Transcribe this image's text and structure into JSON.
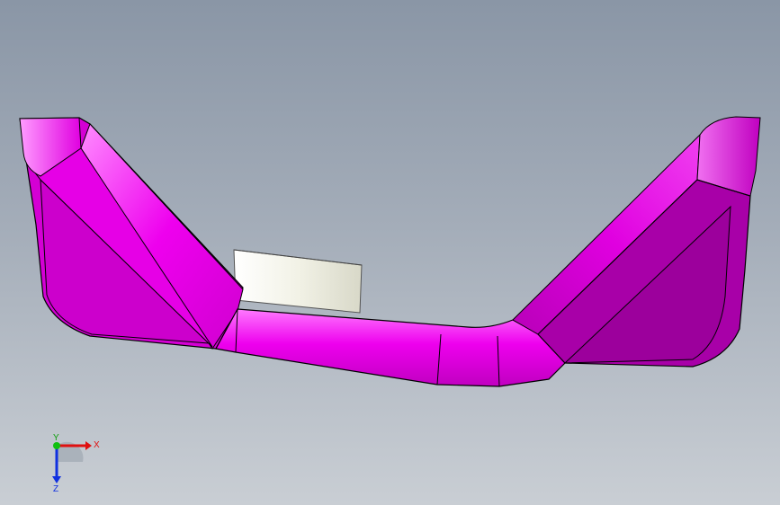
{
  "viewport": {
    "background_top": "#8a96a6",
    "background_bottom": "#c9ced4"
  },
  "model": {
    "part_color": "#ee00ee",
    "part_shadow_color": "#b000b0",
    "edge_color": "#000000",
    "insert_color": "#f2f2e6"
  },
  "triad": {
    "x_label": "X",
    "y_label": "Y",
    "z_label": "Z",
    "x_color": "#e01010",
    "y_color": "#10c010",
    "z_color": "#1030e0"
  }
}
